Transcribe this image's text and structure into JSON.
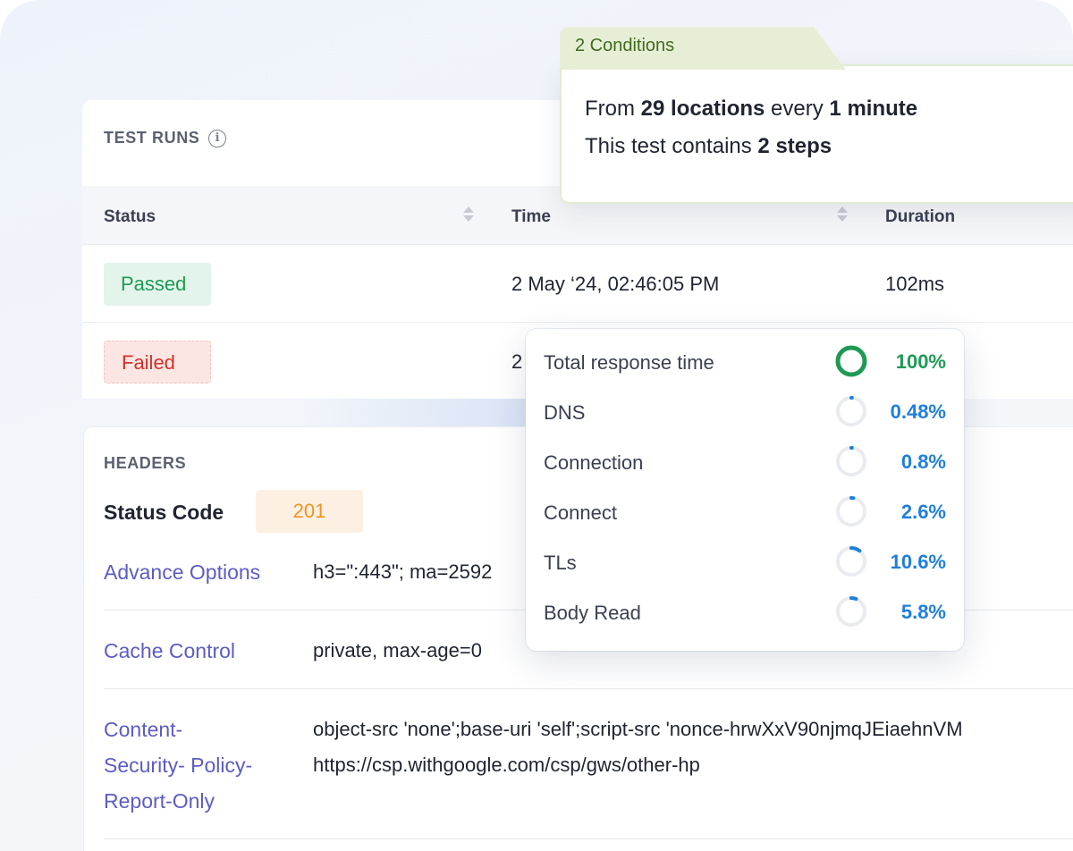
{
  "test_runs": {
    "title": "TEST RUNS",
    "columns": {
      "status": "Status",
      "time": "Time",
      "duration": "Duration"
    },
    "rows": [
      {
        "status": "Passed",
        "time": "2 May ‘24, 02:46:05 PM",
        "duration": "102ms"
      },
      {
        "status": "Failed",
        "time": "2",
        "duration": ""
      }
    ]
  },
  "headers": {
    "title": "HEADERS",
    "status_code_label": "Status Code",
    "status_code_value": "201",
    "items": [
      {
        "key": "Advance Options",
        "value": "h3=\":443\"; ma=2592"
      },
      {
        "key": "Cache Control",
        "value": "private, max-age=0"
      },
      {
        "key_lines": [
          "Content-",
          "Security- Policy-",
          "Report-Only"
        ],
        "value_lines": [
          "object-src 'none';base-uri 'self';script-src 'nonce-hrwXxV90njmqJEiaehnVM",
          "https://csp.withgoogle.com/csp/gws/other-hp"
        ]
      }
    ]
  },
  "conditions": {
    "tab": "2 Conditions",
    "line1": {
      "pre": "From ",
      "b1": "29 locations",
      "mid": " every ",
      "b2": "1 minute"
    },
    "line2": {
      "pre": "This test contains ",
      "b1": "2 steps"
    }
  },
  "response_time": {
    "items": [
      {
        "label": "Total response time",
        "value": "100%",
        "fraction": 1.0,
        "color": "#1e9a55"
      },
      {
        "label": "DNS",
        "value": "0.48%",
        "fraction": 0.0048,
        "color": "#1f7fdc"
      },
      {
        "label": "Connection",
        "value": "0.8%",
        "fraction": 0.008,
        "color": "#1f7fdc"
      },
      {
        "label": "Connect",
        "value": "2.6%",
        "fraction": 0.026,
        "color": "#1f7fdc"
      },
      {
        "label": "TLs",
        "value": "10.6%",
        "fraction": 0.106,
        "color": "#1f7fdc"
      },
      {
        "label": "Body Read",
        "value": "5.8%",
        "fraction": 0.058,
        "color": "#1f7fdc"
      }
    ]
  },
  "icons": {
    "info": "info-icon",
    "sort": "sort-icon"
  }
}
